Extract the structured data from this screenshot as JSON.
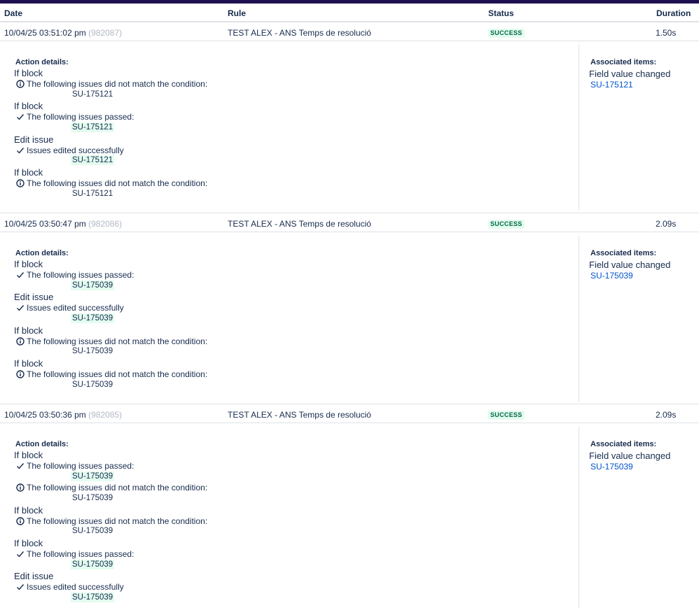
{
  "header": {
    "date": "Date",
    "rule": "Rule",
    "status": "Status",
    "duration": "Duration"
  },
  "labels": {
    "action_details": "Action details:",
    "associated_items": "Associated items:"
  },
  "colors": {
    "topbar": "#1f0f4f",
    "success_bg": "#e3fcef",
    "success_text": "#006644",
    "link": "#0052cc"
  },
  "entries": [
    {
      "date": "10/04/25 03:51:02 pm",
      "id": "(982087)",
      "rule": "TEST ALEX - ANS Temps de resolució",
      "status": "SUCCESS",
      "duration": "1.50s",
      "associated_text": "Field value changed",
      "associated_link": "SU-175121",
      "blocks": [
        {
          "title": "If block",
          "lines": [
            {
              "icon": "info-icon",
              "text": "The following issues did not match the condition:",
              "issue": "SU-175121",
              "highlight": false
            }
          ]
        },
        {
          "title": "If block",
          "lines": [
            {
              "icon": "check-icon",
              "text": "The following issues passed:",
              "issue": "SU-175121",
              "highlight": true
            }
          ]
        },
        {
          "title": "Edit issue",
          "lines": [
            {
              "icon": "check-icon",
              "text": "Issues edited successfully",
              "issue": "SU-175121",
              "highlight": true
            }
          ]
        },
        {
          "title": "If block",
          "lines": [
            {
              "icon": "info-icon",
              "text": "The following issues did not match the condition:",
              "issue": "SU-175121",
              "highlight": false
            }
          ]
        }
      ]
    },
    {
      "date": "10/04/25 03:50:47 pm",
      "id": "(982086)",
      "rule": "TEST ALEX - ANS Temps de resolució",
      "status": "SUCCESS",
      "duration": "2.09s",
      "associated_text": "Field value changed",
      "associated_link": "SU-175039",
      "blocks": [
        {
          "title": "If block",
          "lines": [
            {
              "icon": "check-icon",
              "text": "The following issues passed:",
              "issue": "SU-175039",
              "highlight": true
            }
          ]
        },
        {
          "title": "Edit issue",
          "lines": [
            {
              "icon": "check-icon",
              "text": "Issues edited successfully",
              "issue": "SU-175039",
              "highlight": true
            }
          ]
        },
        {
          "title": "If block",
          "lines": [
            {
              "icon": "info-icon",
              "text": "The following issues did not match the condition:",
              "issue": "SU-175039",
              "highlight": false
            }
          ]
        },
        {
          "title": "If block",
          "lines": [
            {
              "icon": "info-icon",
              "text": "The following issues did not match the condition:",
              "issue": "SU-175039",
              "highlight": false
            }
          ]
        }
      ]
    },
    {
      "date": "10/04/25 03:50:36 pm",
      "id": "(982085)",
      "rule": "TEST ALEX - ANS Temps de resolució",
      "status": "SUCCESS",
      "duration": "2.09s",
      "associated_text": "Field value changed",
      "associated_link": "SU-175039",
      "blocks": [
        {
          "title": "If block",
          "lines": [
            {
              "icon": "check-icon",
              "text": "The following issues passed:",
              "issue": "SU-175039",
              "highlight": true
            },
            {
              "icon": "info-icon",
              "text": "The following issues did not match the condition:",
              "issue": "SU-175039",
              "highlight": false
            }
          ]
        },
        {
          "title": "If block",
          "lines": [
            {
              "icon": "info-icon",
              "text": "The following issues did not match the condition:",
              "issue": "SU-175039",
              "highlight": false
            }
          ]
        },
        {
          "title": "If block",
          "lines": [
            {
              "icon": "check-icon",
              "text": "The following issues passed:",
              "issue": "SU-175039",
              "highlight": true
            }
          ]
        },
        {
          "title": "Edit issue",
          "lines": [
            {
              "icon": "check-icon",
              "text": "Issues edited successfully",
              "issue": "SU-175039",
              "highlight": true
            }
          ]
        }
      ]
    }
  ]
}
